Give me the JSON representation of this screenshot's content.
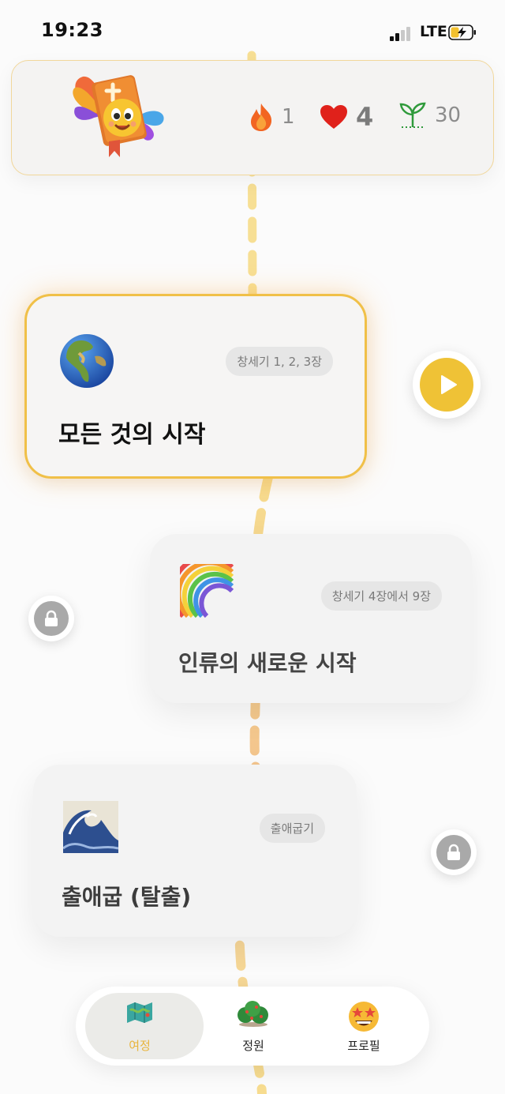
{
  "status_bar": {
    "time": "19:23",
    "network": "LTE"
  },
  "header": {
    "streak": "1",
    "hearts": "4",
    "seeds": "30"
  },
  "lessons": [
    {
      "badge": "창세기 1, 2, 3장",
      "title": "모든 것의 시작",
      "icon": "globe-icon",
      "state": "current"
    },
    {
      "badge": "창세기 4장에서 9장",
      "title": "인류의 새로운 시작",
      "icon": "rainbow-icon",
      "state": "locked"
    },
    {
      "badge": "출애굽기",
      "title": "출애굽 (탈출)",
      "icon": "wave-icon",
      "state": "locked"
    }
  ],
  "nav": [
    {
      "label": "여정",
      "icon": "map-icon",
      "active": true
    },
    {
      "label": "정원",
      "icon": "bush-icon",
      "active": false
    },
    {
      "label": "프로필",
      "icon": "star-struck-face-icon",
      "active": false
    }
  ],
  "colors": {
    "accent": "#efc236",
    "card_border": "#f0c048",
    "path": "#f5d77a"
  }
}
